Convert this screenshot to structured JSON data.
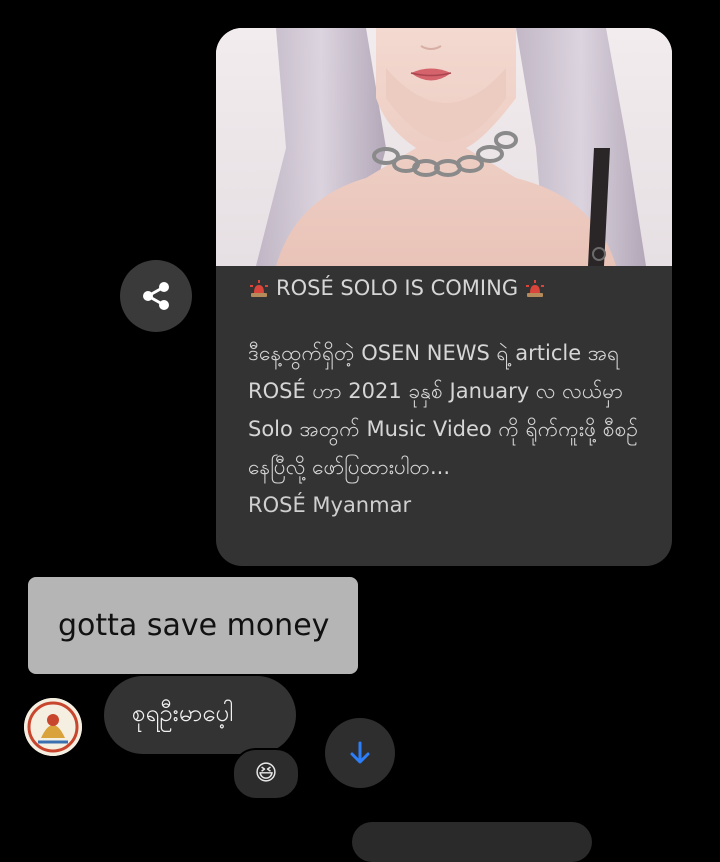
{
  "shared_post": {
    "title": "ROSÉ SOLO IS COMING",
    "title_icon": "rotating-light-icon",
    "description": "ဒီနေ့ထွက်ရှိတဲ့ OSEN NEWS ရဲ့ article အရ ROSÉ ဟာ 2021 ခုနှစ် January လ လယ်မှာ Solo အတွက် Music Video ကို ရိုက်ကူးဖို့ စီစဉ်နေပြီလို့ ဖော်ပြထားပါတ...",
    "source": "ROSÉ Myanmar",
    "image_alt": "photo"
  },
  "share_button": {
    "icon": "share-icon"
  },
  "message": {
    "text": "gotta save money"
  },
  "reply": {
    "text": "စုရဦးမာပေ့ါ",
    "reaction_icon": "grinning-squinting-face-icon",
    "reaction_glyph": "😆"
  },
  "scroll_down": {
    "icon": "arrow-down-icon"
  },
  "colors": {
    "background": "#000000",
    "card": "#333333",
    "message_bubble": "#b5b5b5",
    "accent_blue": "#2d7ff9"
  }
}
